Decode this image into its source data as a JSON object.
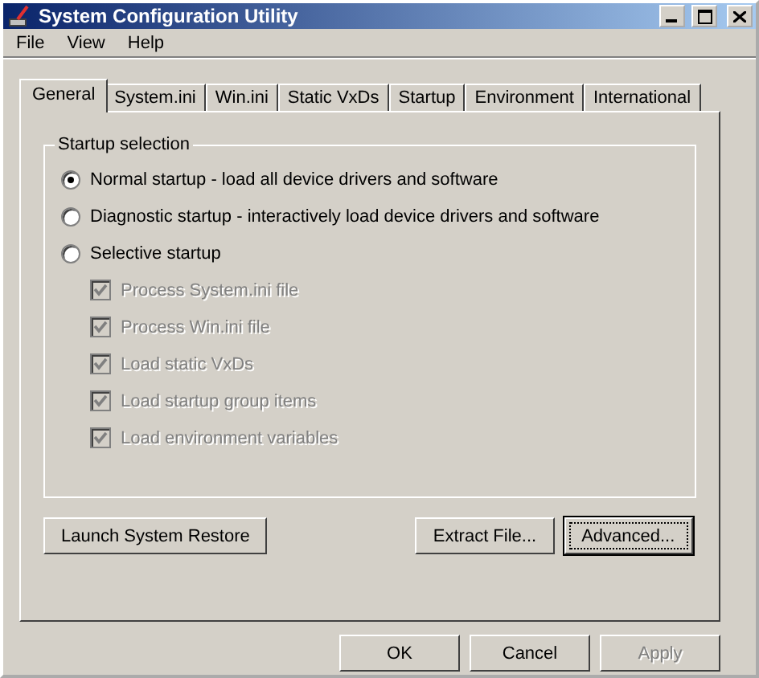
{
  "window": {
    "title": "System Configuration Utility"
  },
  "menu": [
    "File",
    "View",
    "Help"
  ],
  "tabs": [
    {
      "label": "General",
      "selected": true
    },
    {
      "label": "System.ini",
      "selected": false
    },
    {
      "label": "Win.ini",
      "selected": false
    },
    {
      "label": "Static VxDs",
      "selected": false
    },
    {
      "label": "Startup",
      "selected": false
    },
    {
      "label": "Environment",
      "selected": false
    },
    {
      "label": "International",
      "selected": false
    }
  ],
  "group": {
    "title": "Startup selection",
    "radios": [
      {
        "label": "Normal startup - load all device drivers and software",
        "selected": true
      },
      {
        "label": "Diagnostic startup - interactively load device drivers and software",
        "selected": false
      },
      {
        "label": "Selective startup",
        "selected": false
      }
    ],
    "checkboxes": [
      {
        "label": "Process System.ini file",
        "checked": true,
        "disabled": true
      },
      {
        "label": "Process Win.ini file",
        "checked": true,
        "disabled": true
      },
      {
        "label": "Load static VxDs",
        "checked": true,
        "disabled": true
      },
      {
        "label": "Load startup group items",
        "checked": true,
        "disabled": true
      },
      {
        "label": "Load environment variables",
        "checked": true,
        "disabled": true
      }
    ]
  },
  "panel_buttons": [
    {
      "label": "Launch System Restore",
      "focused": false
    },
    {
      "label": "Extract File...",
      "focused": false
    },
    {
      "label": "Advanced...",
      "focused": true
    }
  ],
  "dialog_buttons": [
    {
      "label": "OK",
      "disabled": false
    },
    {
      "label": "Cancel",
      "disabled": false
    },
    {
      "label": "Apply",
      "disabled": true
    }
  ]
}
